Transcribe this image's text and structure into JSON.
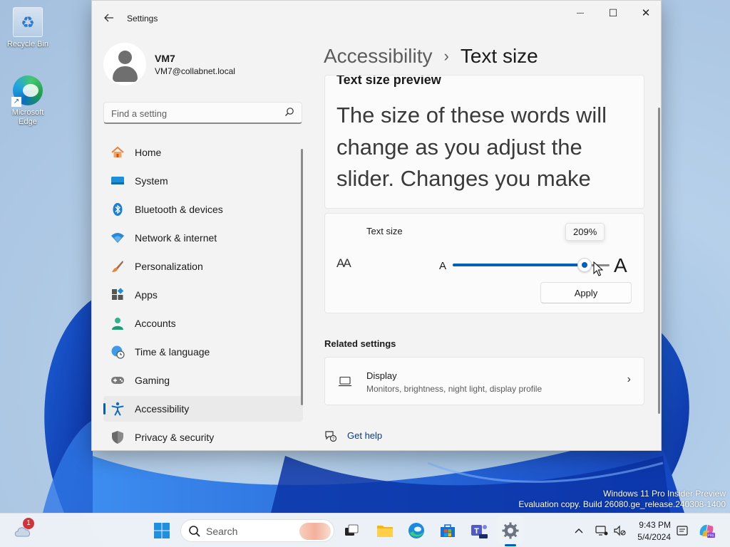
{
  "desktop": {
    "icons": [
      {
        "label": "Recycle Bin"
      },
      {
        "label": "Microsoft Edge"
      }
    ],
    "watermark": {
      "line1": "Windows 11 Pro Insider Preview",
      "line2": "Evaluation copy. Build 26080.ge_release.240308-1400"
    }
  },
  "window": {
    "title": "Settings",
    "back_icon": "back-arrow-icon",
    "controls": {
      "minimize": "—",
      "maximize": "☐",
      "close": "✕"
    },
    "user": {
      "name": "VM7",
      "email": "VM7@collabnet.local"
    },
    "search": {
      "placeholder": "Find a setting",
      "value": ""
    },
    "nav": [
      {
        "label": "Home",
        "icon": "home-icon",
        "selected": false
      },
      {
        "label": "System",
        "icon": "system-icon",
        "selected": false
      },
      {
        "label": "Bluetooth & devices",
        "icon": "bluetooth-icon",
        "selected": false
      },
      {
        "label": "Network & internet",
        "icon": "wifi-icon",
        "selected": false
      },
      {
        "label": "Personalization",
        "icon": "brush-icon",
        "selected": false
      },
      {
        "label": "Apps",
        "icon": "apps-icon",
        "selected": false
      },
      {
        "label": "Accounts",
        "icon": "accounts-icon",
        "selected": false
      },
      {
        "label": "Time & language",
        "icon": "globe-clock-icon",
        "selected": false
      },
      {
        "label": "Gaming",
        "icon": "gamepad-icon",
        "selected": false
      },
      {
        "label": "Accessibility",
        "icon": "accessibility-icon",
        "selected": true
      },
      {
        "label": "Privacy & security",
        "icon": "shield-icon",
        "selected": false
      }
    ],
    "breadcrumb": {
      "parent": "Accessibility",
      "separator": "›",
      "current": "Text size"
    },
    "preview": {
      "heading": "Text size preview",
      "body": "The size of these words will change as you adjust the slider. Changes you make"
    },
    "text_size": {
      "label": "Text size",
      "icon_glyph": "AA",
      "small_a": "A",
      "large_a": "A",
      "tooltip": "209%",
      "slider_fraction": 0.84,
      "apply_label": "Apply"
    },
    "related": {
      "heading": "Related settings",
      "display": {
        "title": "Display",
        "subtitle": "Monitors, brightness, night light, display profile",
        "chevron": "›"
      }
    },
    "help": {
      "label": "Get help"
    }
  },
  "taskbar": {
    "search_label": "Search",
    "weather_badge": "1",
    "time": "9:43 PM",
    "date": "5/4/2024",
    "accent": "#005fb8"
  }
}
